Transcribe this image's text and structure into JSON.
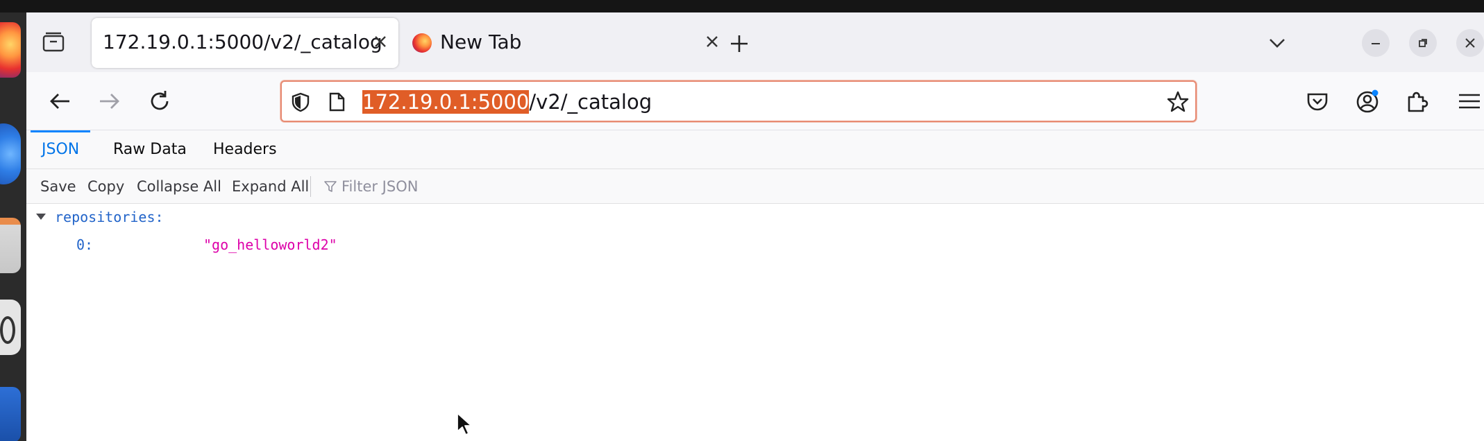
{
  "browser": {
    "tabs": [
      {
        "title": "172.19.0.1:5000/v2/_catalog",
        "active": true
      },
      {
        "title": "New Tab",
        "active": false
      }
    ],
    "url": {
      "host": "172.19.0.1:5000",
      "path": "/v2/_catalog"
    }
  },
  "json_viewer": {
    "tabs": [
      "JSON",
      "Raw Data",
      "Headers"
    ],
    "selected_tab": "JSON",
    "toolbar": {
      "save": "Save",
      "copy": "Copy",
      "collapse_all": "Collapse All",
      "expand_all": "Expand All",
      "filter_placeholder": "Filter JSON"
    },
    "tree": {
      "root_key": "repositories:",
      "items": [
        {
          "key": "0:",
          "value": "\"go_helloworld2\""
        }
      ]
    }
  },
  "colors": {
    "accent_blue": "#0a84ff",
    "url_highlight": "#e05d27",
    "json_key": "#2264c9",
    "json_string": "#dd00a9"
  }
}
